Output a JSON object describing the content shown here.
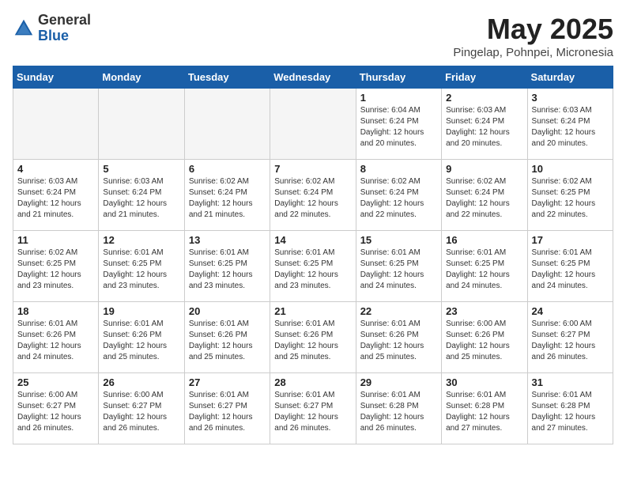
{
  "header": {
    "logo_general": "General",
    "logo_blue": "Blue",
    "month_title": "May 2025",
    "location": "Pingelap, Pohnpei, Micronesia"
  },
  "days_of_week": [
    "Sunday",
    "Monday",
    "Tuesday",
    "Wednesday",
    "Thursday",
    "Friday",
    "Saturday"
  ],
  "weeks": [
    [
      {
        "day": "",
        "info": ""
      },
      {
        "day": "",
        "info": ""
      },
      {
        "day": "",
        "info": ""
      },
      {
        "day": "",
        "info": ""
      },
      {
        "day": "1",
        "info": "Sunrise: 6:04 AM\nSunset: 6:24 PM\nDaylight: 12 hours\nand 20 minutes."
      },
      {
        "day": "2",
        "info": "Sunrise: 6:03 AM\nSunset: 6:24 PM\nDaylight: 12 hours\nand 20 minutes."
      },
      {
        "day": "3",
        "info": "Sunrise: 6:03 AM\nSunset: 6:24 PM\nDaylight: 12 hours\nand 20 minutes."
      }
    ],
    [
      {
        "day": "4",
        "info": "Sunrise: 6:03 AM\nSunset: 6:24 PM\nDaylight: 12 hours\nand 21 minutes."
      },
      {
        "day": "5",
        "info": "Sunrise: 6:03 AM\nSunset: 6:24 PM\nDaylight: 12 hours\nand 21 minutes."
      },
      {
        "day": "6",
        "info": "Sunrise: 6:02 AM\nSunset: 6:24 PM\nDaylight: 12 hours\nand 21 minutes."
      },
      {
        "day": "7",
        "info": "Sunrise: 6:02 AM\nSunset: 6:24 PM\nDaylight: 12 hours\nand 22 minutes."
      },
      {
        "day": "8",
        "info": "Sunrise: 6:02 AM\nSunset: 6:24 PM\nDaylight: 12 hours\nand 22 minutes."
      },
      {
        "day": "9",
        "info": "Sunrise: 6:02 AM\nSunset: 6:24 PM\nDaylight: 12 hours\nand 22 minutes."
      },
      {
        "day": "10",
        "info": "Sunrise: 6:02 AM\nSunset: 6:25 PM\nDaylight: 12 hours\nand 22 minutes."
      }
    ],
    [
      {
        "day": "11",
        "info": "Sunrise: 6:02 AM\nSunset: 6:25 PM\nDaylight: 12 hours\nand 23 minutes."
      },
      {
        "day": "12",
        "info": "Sunrise: 6:01 AM\nSunset: 6:25 PM\nDaylight: 12 hours\nand 23 minutes."
      },
      {
        "day": "13",
        "info": "Sunrise: 6:01 AM\nSunset: 6:25 PM\nDaylight: 12 hours\nand 23 minutes."
      },
      {
        "day": "14",
        "info": "Sunrise: 6:01 AM\nSunset: 6:25 PM\nDaylight: 12 hours\nand 23 minutes."
      },
      {
        "day": "15",
        "info": "Sunrise: 6:01 AM\nSunset: 6:25 PM\nDaylight: 12 hours\nand 24 minutes."
      },
      {
        "day": "16",
        "info": "Sunrise: 6:01 AM\nSunset: 6:25 PM\nDaylight: 12 hours\nand 24 minutes."
      },
      {
        "day": "17",
        "info": "Sunrise: 6:01 AM\nSunset: 6:25 PM\nDaylight: 12 hours\nand 24 minutes."
      }
    ],
    [
      {
        "day": "18",
        "info": "Sunrise: 6:01 AM\nSunset: 6:26 PM\nDaylight: 12 hours\nand 24 minutes."
      },
      {
        "day": "19",
        "info": "Sunrise: 6:01 AM\nSunset: 6:26 PM\nDaylight: 12 hours\nand 25 minutes."
      },
      {
        "day": "20",
        "info": "Sunrise: 6:01 AM\nSunset: 6:26 PM\nDaylight: 12 hours\nand 25 minutes."
      },
      {
        "day": "21",
        "info": "Sunrise: 6:01 AM\nSunset: 6:26 PM\nDaylight: 12 hours\nand 25 minutes."
      },
      {
        "day": "22",
        "info": "Sunrise: 6:01 AM\nSunset: 6:26 PM\nDaylight: 12 hours\nand 25 minutes."
      },
      {
        "day": "23",
        "info": "Sunrise: 6:00 AM\nSunset: 6:26 PM\nDaylight: 12 hours\nand 25 minutes."
      },
      {
        "day": "24",
        "info": "Sunrise: 6:00 AM\nSunset: 6:27 PM\nDaylight: 12 hours\nand 26 minutes."
      }
    ],
    [
      {
        "day": "25",
        "info": "Sunrise: 6:00 AM\nSunset: 6:27 PM\nDaylight: 12 hours\nand 26 minutes."
      },
      {
        "day": "26",
        "info": "Sunrise: 6:00 AM\nSunset: 6:27 PM\nDaylight: 12 hours\nand 26 minutes."
      },
      {
        "day": "27",
        "info": "Sunrise: 6:01 AM\nSunset: 6:27 PM\nDaylight: 12 hours\nand 26 minutes."
      },
      {
        "day": "28",
        "info": "Sunrise: 6:01 AM\nSunset: 6:27 PM\nDaylight: 12 hours\nand 26 minutes."
      },
      {
        "day": "29",
        "info": "Sunrise: 6:01 AM\nSunset: 6:28 PM\nDaylight: 12 hours\nand 26 minutes."
      },
      {
        "day": "30",
        "info": "Sunrise: 6:01 AM\nSunset: 6:28 PM\nDaylight: 12 hours\nand 27 minutes."
      },
      {
        "day": "31",
        "info": "Sunrise: 6:01 AM\nSunset: 6:28 PM\nDaylight: 12 hours\nand 27 minutes."
      }
    ]
  ]
}
